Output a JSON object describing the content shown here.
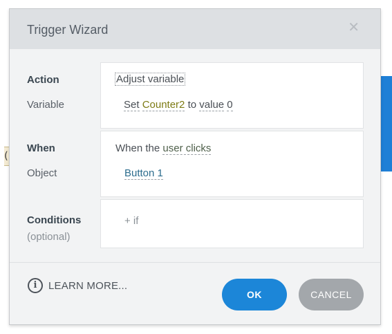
{
  "dialog": {
    "title": "Trigger Wizard",
    "close_glyph": "✕"
  },
  "action": {
    "label": "Action",
    "variable_label": "Variable",
    "action_value": "Adjust variable",
    "set_word": "Set",
    "variable_name": "Counter2",
    "to_word": "to",
    "value_word": "value",
    "value": "0"
  },
  "when": {
    "label": "When",
    "object_label": "Object",
    "prefix": "When the",
    "event": "user clicks",
    "object_value": "Button 1"
  },
  "conditions": {
    "label": "Conditions",
    "sub_label": "(optional)",
    "add_text": "+ if"
  },
  "footer": {
    "info_glyph": "i",
    "learn_more": "LEARN MORE...",
    "ok": "OK",
    "cancel": "CANCEL"
  },
  "background": {
    "fragment_char": "("
  },
  "colors": {
    "primary_button": "#1c86d8",
    "cancel_button": "#a3a7ab",
    "header": "#dde0e3",
    "variable_token": "#7d7b14",
    "object_token": "#2d6d8e"
  },
  "icons": [
    "close-icon",
    "info-icon"
  ]
}
